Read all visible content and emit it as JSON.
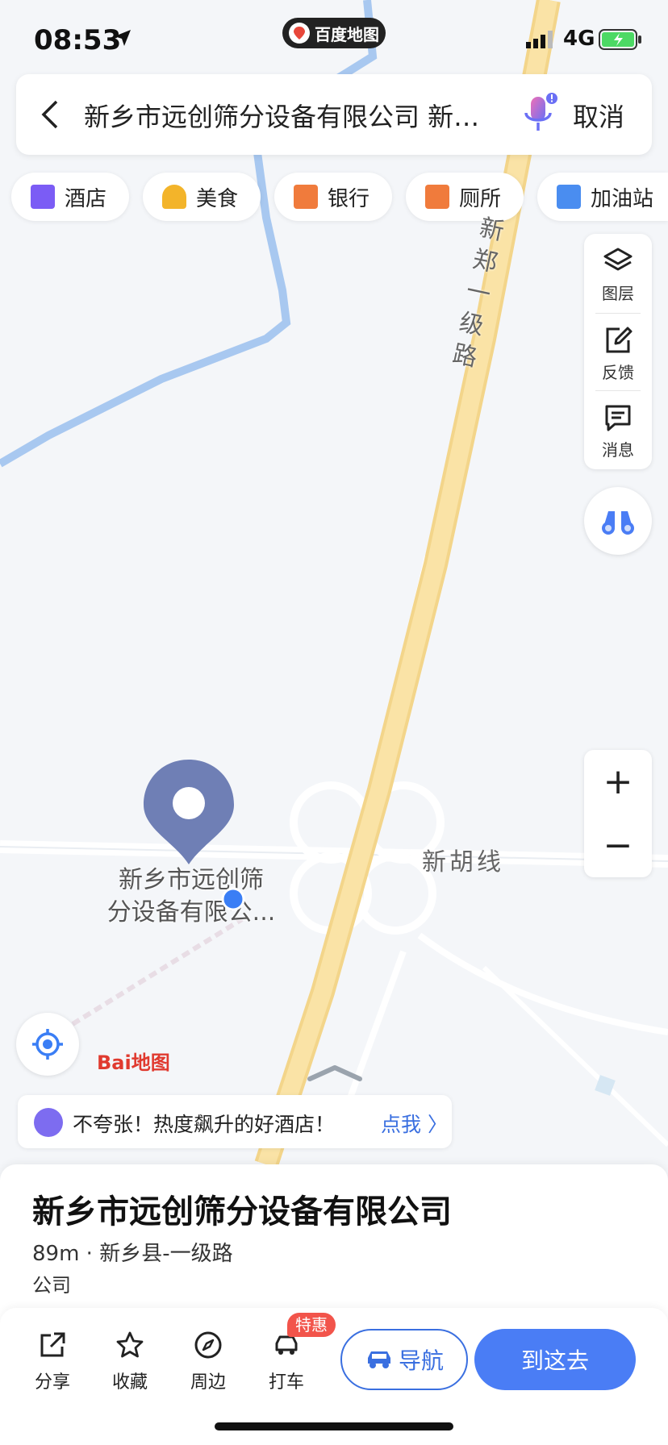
{
  "status_bar": {
    "time": "08:53",
    "app_name": "百度地图",
    "network": "4G"
  },
  "search": {
    "query": "新乡市远创筛分设备有限公司 新…",
    "cancel_label": "取消"
  },
  "categories": [
    {
      "label": "酒店",
      "icon": "hotel-icon",
      "color": "#7b5cf5"
    },
    {
      "label": "美食",
      "icon": "food-icon",
      "color": "#f3b42a"
    },
    {
      "label": "银行",
      "icon": "bank-icon",
      "color": "#f07b3c"
    },
    {
      "label": "厕所",
      "icon": "toilet-icon",
      "color": "#f07b3c"
    },
    {
      "label": "加油站",
      "icon": "gas-station-icon",
      "color": "#4a8df0"
    }
  ],
  "side_panel": {
    "layers_label": "图层",
    "feedback_label": "反馈",
    "messages_label": "消息"
  },
  "map": {
    "pin_label_line1": "新乡市远创筛",
    "pin_label_line2": "分设备有限公...",
    "road_vertical": "新郑一级路",
    "road_horizontal": "新胡线",
    "logo_text": "Bai地图"
  },
  "zoom": {
    "in": "+",
    "out": "−"
  },
  "promo": {
    "text": "不夸张！热度飙升的好酒店！",
    "cta": "点我 〉"
  },
  "poi": {
    "title": "新乡市远创筛分设备有限公司",
    "subtitle": "89m · 新乡县-一级路",
    "category": "公司"
  },
  "actions": {
    "share": "分享",
    "favorite": "收藏",
    "nearby": "周边",
    "taxi": "打车",
    "taxi_badge": "特惠",
    "navigate": "导航",
    "go_here": "到这去"
  },
  "colors": {
    "accent": "#4a7df5",
    "road_major": "#f9de9a",
    "river": "#a8c8f0"
  }
}
